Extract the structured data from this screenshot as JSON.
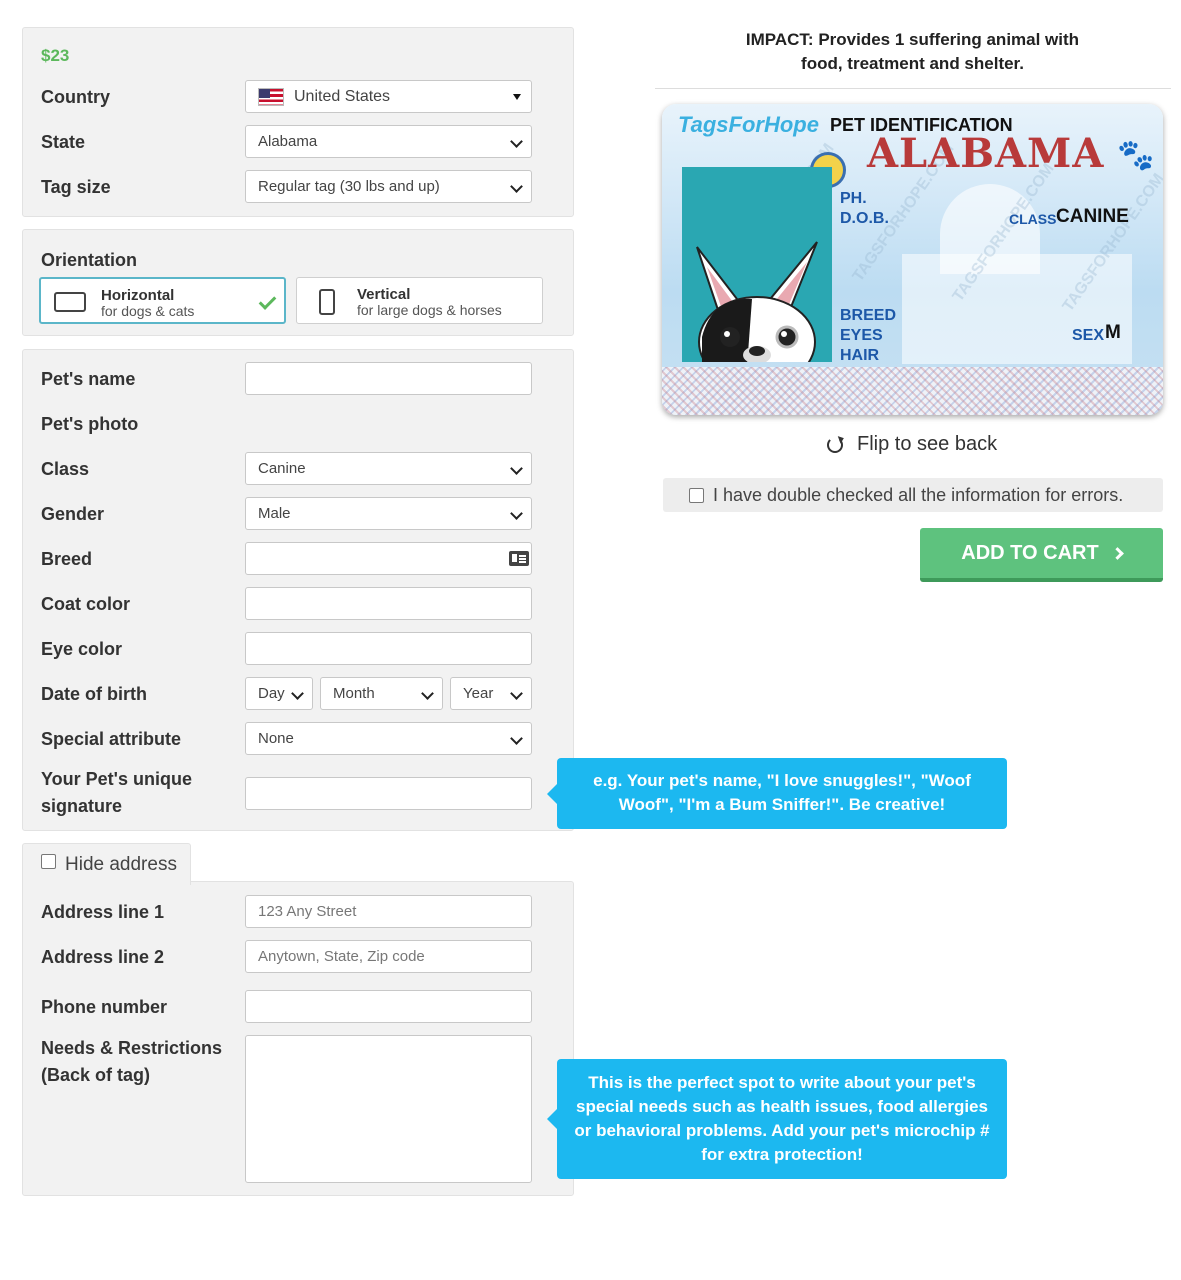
{
  "price": "$23",
  "basics": {
    "country_label": "Country",
    "country_value": "United States",
    "state_label": "State",
    "state_value": "Alabama",
    "tag_size_label": "Tag size",
    "tag_size_value": "Regular tag (30 lbs and up)"
  },
  "orientation": {
    "label": "Orientation",
    "options": [
      {
        "title": "Horizontal",
        "subtitle": "for dogs & cats",
        "selected": true
      },
      {
        "title": "Vertical",
        "subtitle": "for large dogs & horses",
        "selected": false
      }
    ]
  },
  "pet": {
    "name_label": "Pet's name",
    "name_value": "",
    "photo_label": "Pet's photo",
    "class_label": "Class",
    "class_value": "Canine",
    "gender_label": "Gender",
    "gender_value": "Male",
    "breed_label": "Breed",
    "breed_value": "",
    "coat_label": "Coat color",
    "coat_value": "",
    "eye_label": "Eye color",
    "eye_value": "",
    "dob_label": "Date of birth",
    "dob_day": "Day",
    "dob_month": "Month",
    "dob_year": "Year",
    "special_label": "Special attribute",
    "special_value": "None",
    "signature_label": "Your Pet's unique signature",
    "signature_value": ""
  },
  "tooltips": {
    "signature": "e.g. Your pet's name, \"I love snuggles!\", \"Woof Woof\", \"I'm a Bum Sniffer!\". Be creative!",
    "needs": "This is the perfect spot to write about your pet's special needs such as health issues, food allergies or behavioral problems. Add your pet's microchip # for extra protection!"
  },
  "address": {
    "hide_label": "Hide address",
    "hide_checked": false,
    "line1_label": "Address line 1",
    "line1_placeholder": "123 Any Street",
    "line2_label": "Address line 2",
    "line2_placeholder": "Anytown, State, Zip code",
    "phone_label": "Phone number",
    "phone_value": "",
    "needs_label": "Needs & Restrictions (Back of tag)",
    "needs_value": ""
  },
  "preview": {
    "impact": "IMPACT: Provides 1 suffering animal with food, treatment and shelter.",
    "brand": "TagsForHope",
    "card_heading": "PET IDENTIFICATION",
    "card_state": "ALABAMA",
    "field_ph": "PH.",
    "field_dob": "D.O.B.",
    "field_class": "CLASS",
    "class_value": "CANINE",
    "field_breed": "BREED",
    "field_eyes": "EYES",
    "field_hair": "HAIR",
    "field_sex": "SEX",
    "sex_value": "M",
    "watermark": "TAGSFORHOPE.COM",
    "flip_label": "Flip to see back",
    "confirm_label": "I have double checked all the information for errors.",
    "confirm_checked": false,
    "cart_label": "ADD TO CART"
  },
  "colors": {
    "accent_green": "#5ec27e",
    "tooltip_blue": "#1cb8f0",
    "price_green": "#5cb85c",
    "state_red": "#b83a3a"
  }
}
